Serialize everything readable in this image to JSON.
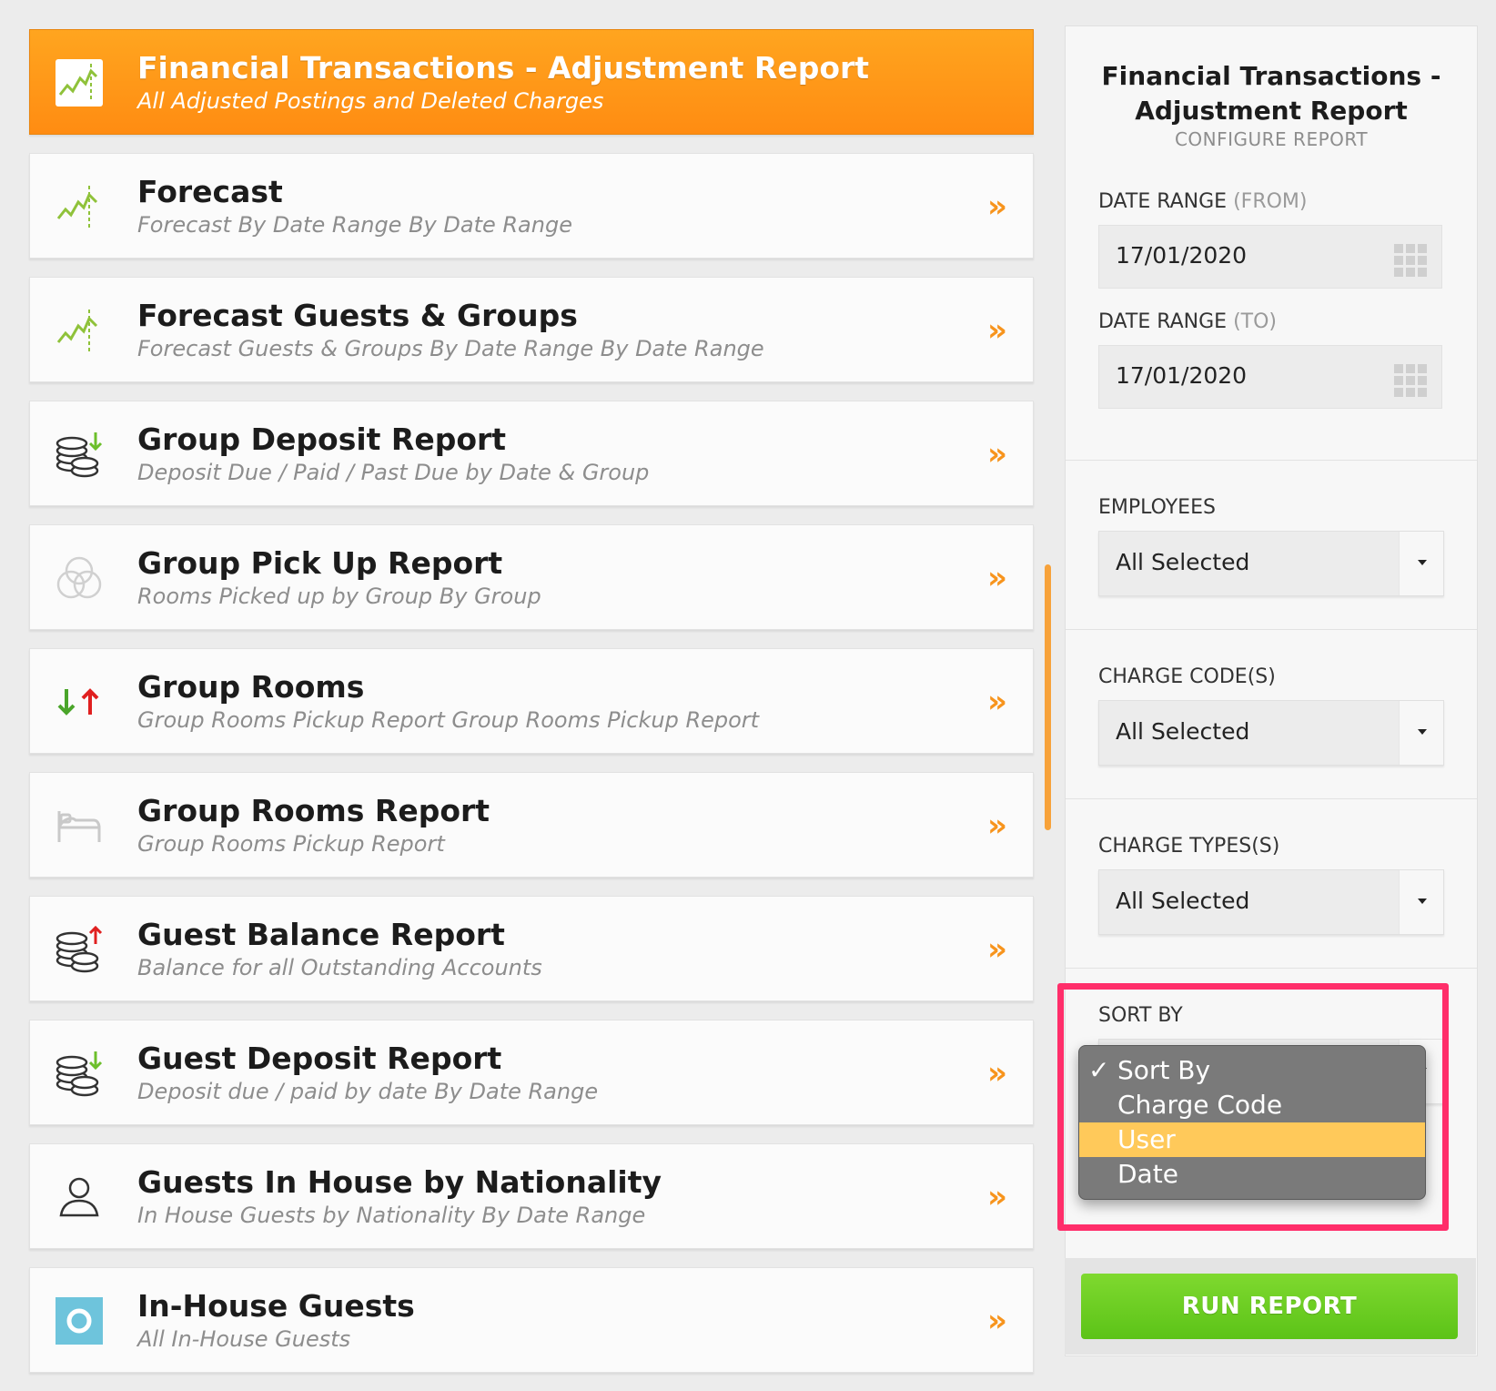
{
  "reports": [
    {
      "title": "Financial Transactions - Adjustment Report",
      "subtitle": "All Adjusted Postings and Deleted Charges",
      "icon": "chart-trend-icon",
      "active": true
    },
    {
      "title": "Forecast",
      "subtitle": "Forecast By Date Range By Date Range",
      "icon": "chart-trend-icon"
    },
    {
      "title": "Forecast Guests & Groups",
      "subtitle": "Forecast Guests & Groups By Date Range By Date Range",
      "icon": "chart-trend-icon"
    },
    {
      "title": "Group Deposit Report",
      "subtitle": "Deposit Due / Paid / Past Due by Date & Group",
      "icon": "coins-down-icon"
    },
    {
      "title": "Group Pick Up Report",
      "subtitle": "Rooms Picked up by Group By Group",
      "icon": "circles-icon"
    },
    {
      "title": "Group Rooms",
      "subtitle": "Group Rooms Pickup Report Group Rooms Pickup Report",
      "icon": "arrows-up-down-icon"
    },
    {
      "title": "Group Rooms Report",
      "subtitle": "Group Rooms Pickup Report",
      "icon": "bed-icon"
    },
    {
      "title": "Guest Balance Report",
      "subtitle": "Balance for all Outstanding Accounts",
      "icon": "coins-up-icon"
    },
    {
      "title": "Guest Deposit Report",
      "subtitle": "Deposit due / paid by date By Date Range",
      "icon": "coins-down-icon"
    },
    {
      "title": "Guests In House by Nationality",
      "subtitle": "In House Guests by Nationality By Date Range",
      "icon": "person-icon"
    },
    {
      "title": "In-House Guests",
      "subtitle": "All In-House Guests",
      "icon": "in-house-icon"
    }
  ],
  "chevron": "»",
  "panel": {
    "title_line1": "Financial Transactions -",
    "title_line2": "Adjustment Report",
    "subtitle": "CONFIGURE REPORT",
    "date_from_label": "DATE RANGE",
    "date_from_hint": "(FROM)",
    "date_from_value": "17/01/2020",
    "date_to_label": "DATE RANGE",
    "date_to_hint": "(TO)",
    "date_to_value": "17/01/2020",
    "employees_label": "EMPLOYEES",
    "employees_value": "All Selected",
    "charge_codes_label": "CHARGE CODE(S)",
    "charge_codes_value": "All Selected",
    "charge_types_label": "CHARGE TYPES(S)",
    "charge_types_value": "All Selected",
    "sort_by_label": "SORT BY",
    "sort_options": [
      {
        "label": "Sort By",
        "checked": true
      },
      {
        "label": "Charge Code"
      },
      {
        "label": "User",
        "highlighted": true
      },
      {
        "label": "Date"
      }
    ],
    "check_mark": "✓",
    "run_label": "RUN REPORT"
  },
  "colors": {
    "accent": "#f7941d",
    "highlight_border": "#ff2e6a",
    "run_green": "#6ccf22",
    "option_highlight": "#ffc95a"
  }
}
